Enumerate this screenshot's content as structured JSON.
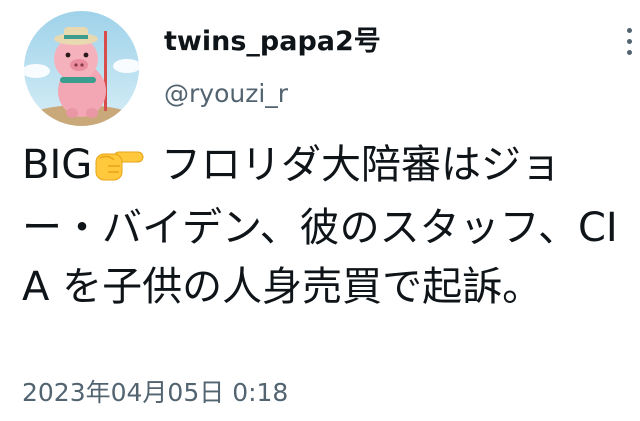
{
  "tweet": {
    "display_name": "twins_papa2号",
    "handle": "@ryouzi_r",
    "text_before_icon": "BIG",
    "icon": "backhand-index-pointing-right-icon",
    "text_after_icon": " フロリダ大陪審はジョー・バイデン、彼のスタッフ、CIA を子供の人身売買で起訴。",
    "timestamp": "2023年04月05日 0:18"
  },
  "colors": {
    "text_primary": "#0f1419",
    "text_secondary": "#536471",
    "emoji_yellow": "#FFC83D"
  }
}
